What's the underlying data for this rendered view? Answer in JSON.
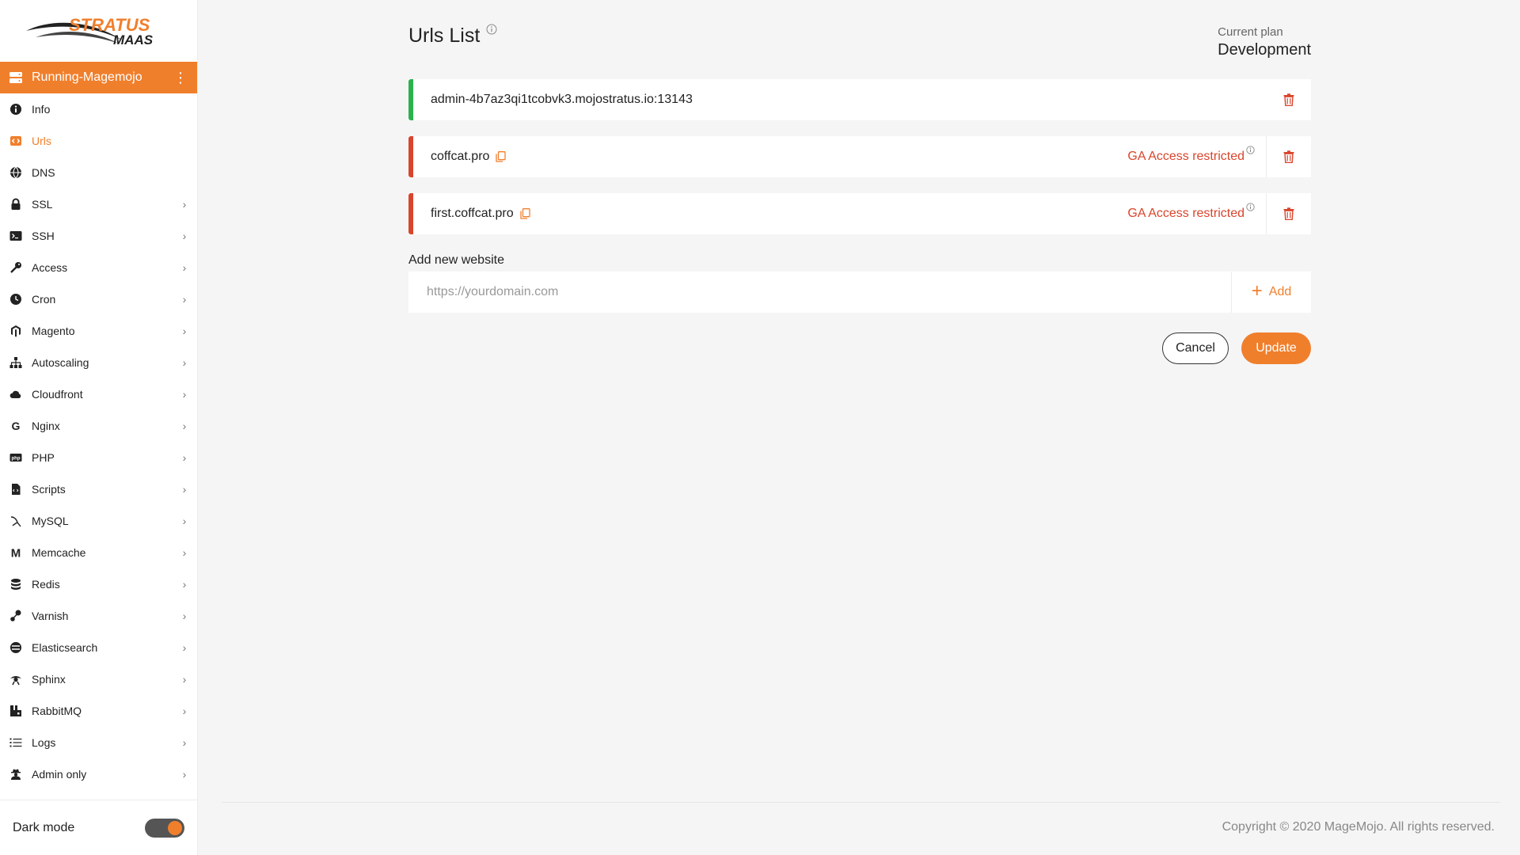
{
  "brand": {
    "logo_line1": "STRATUS",
    "logo_line2": "MAAS",
    "accent": "#f07f2c"
  },
  "server": {
    "name": "Running-Magemojo"
  },
  "sidebar": {
    "items": [
      {
        "label": "Info",
        "icon": "info-icon",
        "chevron": false,
        "active": false
      },
      {
        "label": "Urls",
        "icon": "code-icon",
        "chevron": false,
        "active": true
      },
      {
        "label": "DNS",
        "icon": "globe-icon",
        "chevron": false,
        "active": false
      },
      {
        "label": "SSL",
        "icon": "lock-icon",
        "chevron": true,
        "active": false
      },
      {
        "label": "SSH",
        "icon": "terminal-icon",
        "chevron": true,
        "active": false
      },
      {
        "label": "Access",
        "icon": "key-icon",
        "chevron": true,
        "active": false
      },
      {
        "label": "Cron",
        "icon": "clock-icon",
        "chevron": true,
        "active": false
      },
      {
        "label": "Magento",
        "icon": "magento-icon",
        "chevron": true,
        "active": false
      },
      {
        "label": "Autoscaling",
        "icon": "sitemap-icon",
        "chevron": true,
        "active": false
      },
      {
        "label": "Cloudfront",
        "icon": "cloud-icon",
        "chevron": true,
        "active": false
      },
      {
        "label": "Nginx",
        "icon": "nginx-icon",
        "chevron": true,
        "active": false
      },
      {
        "label": "PHP",
        "icon": "php-icon",
        "chevron": true,
        "active": false
      },
      {
        "label": "Scripts",
        "icon": "file-code-icon",
        "chevron": true,
        "active": false
      },
      {
        "label": "MySQL",
        "icon": "mysql-icon",
        "chevron": true,
        "active": false
      },
      {
        "label": "Memcache",
        "icon": "memcache-icon",
        "chevron": true,
        "active": false
      },
      {
        "label": "Redis",
        "icon": "database-icon",
        "chevron": true,
        "active": false
      },
      {
        "label": "Varnish",
        "icon": "varnish-icon",
        "chevron": true,
        "active": false
      },
      {
        "label": "Elasticsearch",
        "icon": "elasticsearch-icon",
        "chevron": true,
        "active": false
      },
      {
        "label": "Sphinx",
        "icon": "sphinx-icon",
        "chevron": true,
        "active": false
      },
      {
        "label": "RabbitMQ",
        "icon": "rabbitmq-icon",
        "chevron": true,
        "active": false
      },
      {
        "label": "Logs",
        "icon": "list-icon",
        "chevron": true,
        "active": false
      },
      {
        "label": "Admin only",
        "icon": "user-secret-icon",
        "chevron": true,
        "active": false
      }
    ],
    "dark_mode_label": "Dark mode",
    "dark_mode_on": true
  },
  "main": {
    "title": "Urls List",
    "plan_label": "Current plan",
    "plan_value": "Development",
    "urls": [
      {
        "url": "admin-4b7az3qi1tcobvk3.mojostratus.io:13143",
        "status_color": "#2bb24c",
        "restricted_label": "",
        "copyable": false
      },
      {
        "url": "coffcat.pro",
        "status_color": "#d9452c",
        "restricted_label": "GA Access restricted",
        "copyable": true
      },
      {
        "url": "first.coffcat.pro",
        "status_color": "#d9452c",
        "restricted_label": "GA Access restricted",
        "copyable": true
      }
    ],
    "add_label": "Add new website",
    "add_placeholder": "https://yourdomain.com",
    "add_button": "Add",
    "cancel_button": "Cancel",
    "update_button": "Update"
  },
  "footer": {
    "copyright": "Copyright © 2020 MageMojo. All rights reserved."
  }
}
